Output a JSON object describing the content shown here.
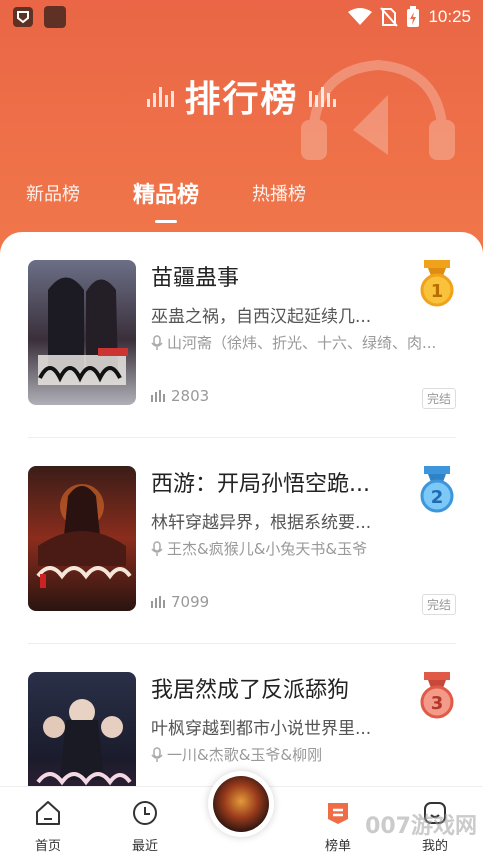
{
  "status_bar": {
    "time": "10:25"
  },
  "header": {
    "title": "排行榜",
    "tabs": [
      {
        "label": "新品榜",
        "active": false
      },
      {
        "label": "精品榜",
        "active": true
      },
      {
        "label": "热播榜",
        "active": false
      }
    ]
  },
  "books": [
    {
      "title": "苗疆蛊事",
      "description": "巫蛊之祸，自西汉起延续几...",
      "author": "山河斋（徐炜、折光、十六、绿绮、肉...",
      "plays": "2803",
      "status": "完结",
      "rank": "1",
      "medal_color": "#f2a81d"
    },
    {
      "title": "西游：开局孙悟空跪...",
      "description": "林轩穿越异界，根据系统要...",
      "author": "王杰&疯猴儿&小兔天书&玉爷",
      "plays": "7099",
      "status": "完结",
      "rank": "2",
      "medal_color": "#4fa8e8"
    },
    {
      "title": "我居然成了反派舔狗",
      "description": "叶枫穿越到都市小说世界里...",
      "author": "一川&杰歌&玉爷&柳刚",
      "plays": "",
      "status": "",
      "rank": "3",
      "medal_color": "#e86a5a"
    }
  ],
  "bottom_nav": {
    "items": [
      {
        "label": "首页",
        "icon": "home-icon"
      },
      {
        "label": "最近",
        "icon": "clock-icon"
      },
      {
        "label": "榜单",
        "icon": "ranking-icon",
        "active": true
      },
      {
        "label": "我的",
        "icon": "profile-icon"
      }
    ]
  },
  "watermark": "007游戏网",
  "colors": {
    "accent": "#ee6c46",
    "medal_gold": "#f2a81d",
    "medal_blue": "#4fa8e8",
    "medal_red": "#e86a5a"
  }
}
